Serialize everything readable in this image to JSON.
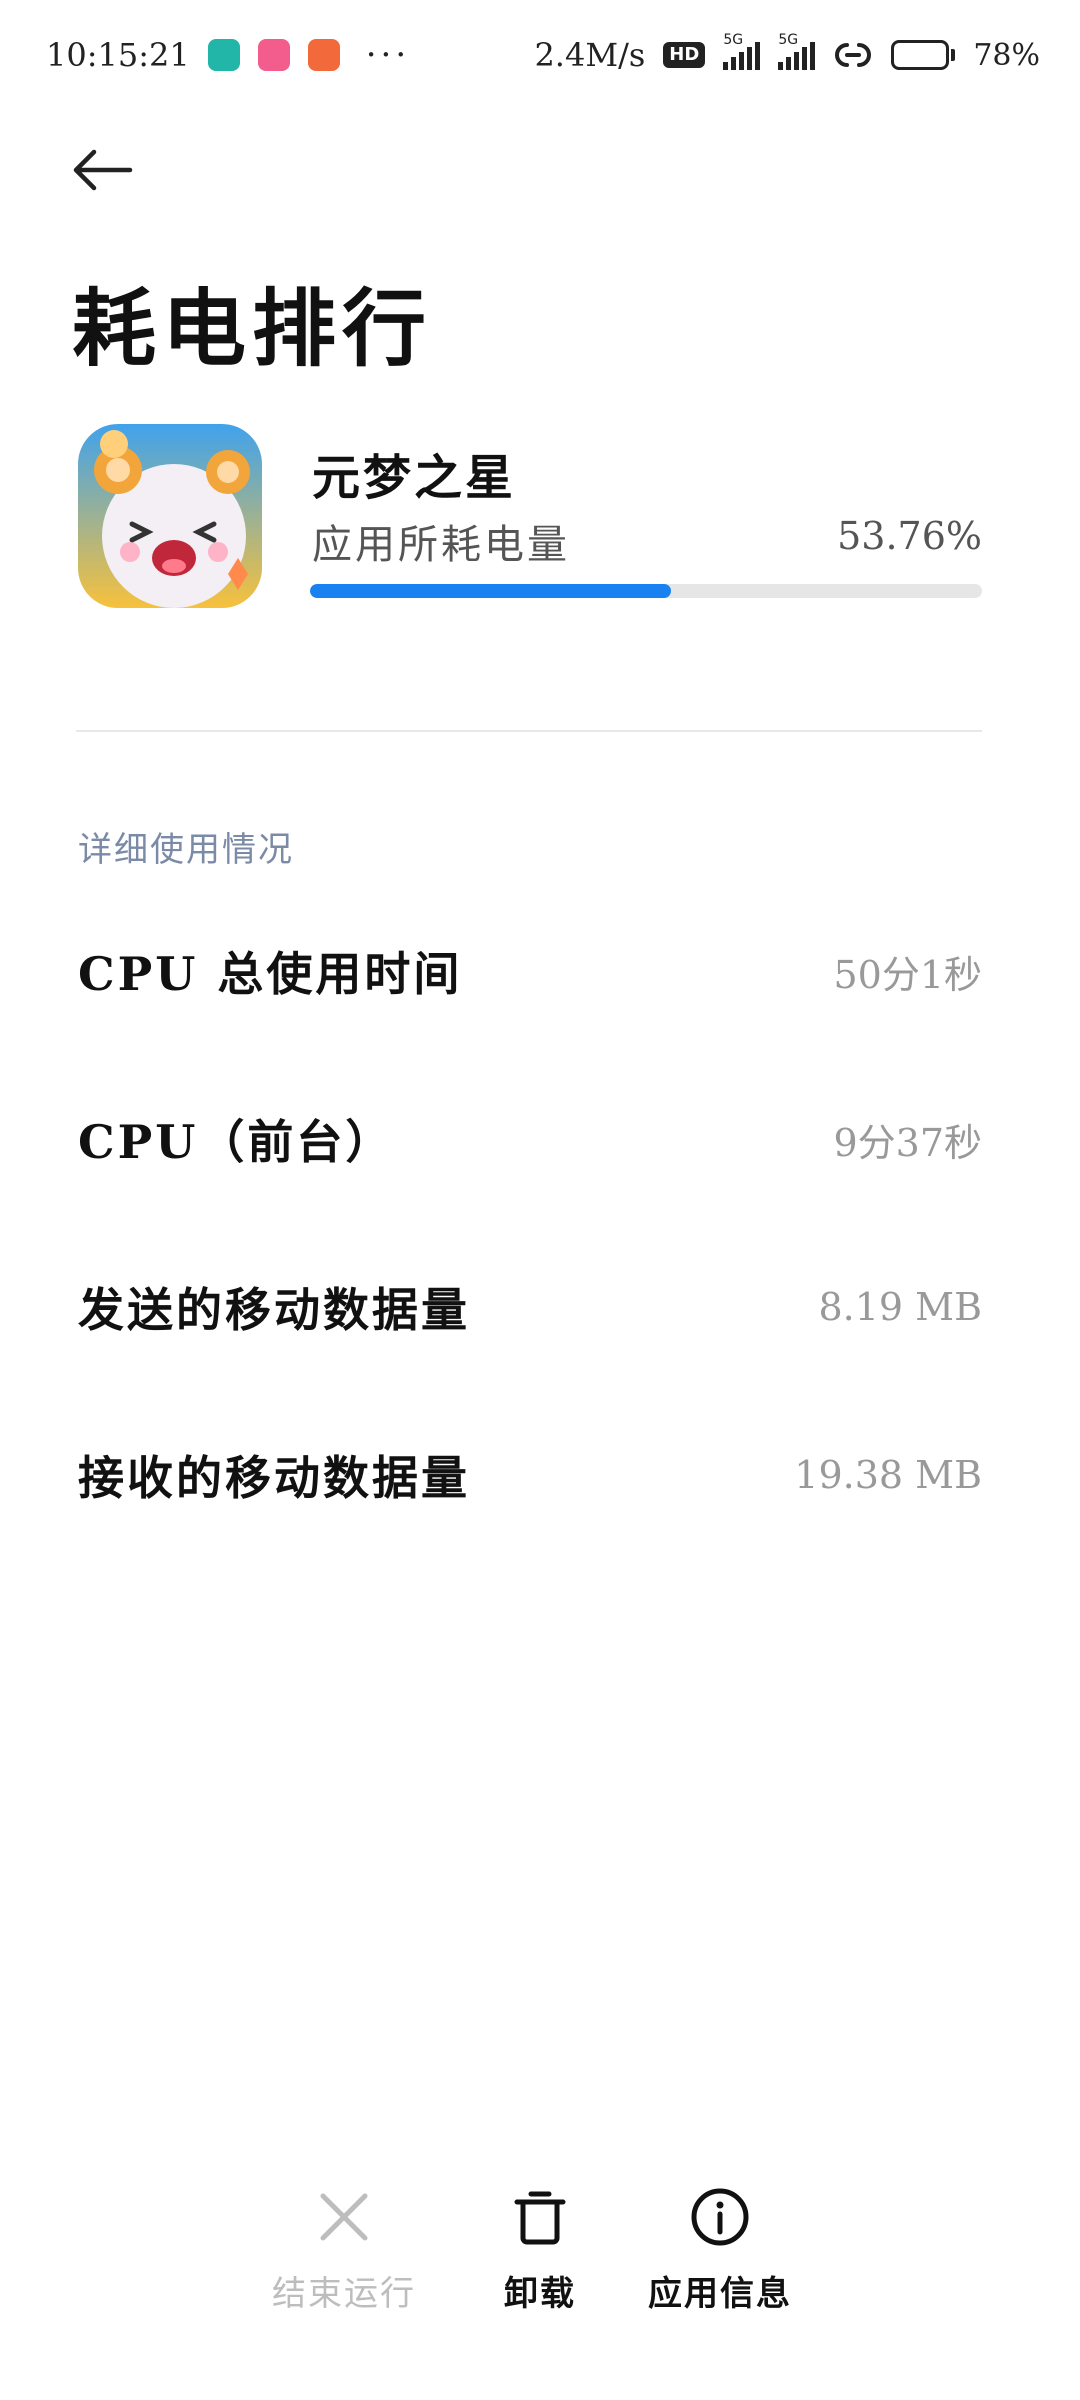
{
  "status_bar": {
    "time": "10:15:21",
    "app_icons": [
      {
        "name": "boss-zhipin-icon",
        "color": "#21b6a8"
      },
      {
        "name": "bilibili-icon",
        "color": "#f25d8e"
      },
      {
        "name": "mi-icon",
        "color": "#f26a3c"
      }
    ],
    "more": "···",
    "net_speed": "2.4M/s",
    "hd_badge": "HD",
    "sim1_label": "5G",
    "sim2_label": "5G",
    "battery_percent": "78%",
    "battery_level": 0.78
  },
  "header": {
    "back_icon": "arrow-left-icon",
    "title": "耗电排行"
  },
  "app": {
    "name": "元梦之星",
    "usage_label": "应用所耗电量",
    "usage_percent_text": "53.76%",
    "usage_fraction": 0.5376,
    "accent_color": "#1a82f0"
  },
  "details": {
    "section_title": "详细使用情况",
    "rows": [
      {
        "label": "CPU 总使用时间",
        "value": "50分1秒"
      },
      {
        "label": "CPU（前台）",
        "value": "9分37秒"
      },
      {
        "label": "发送的移动数据量",
        "value": "8.19 MB"
      },
      {
        "label": "接收的移动数据量",
        "value": "19.38 MB"
      }
    ]
  },
  "actions": [
    {
      "label": "结束运行",
      "icon": "close-icon",
      "enabled": false
    },
    {
      "label": "卸载",
      "icon": "trash-icon",
      "enabled": true
    },
    {
      "label": "应用信息",
      "icon": "info-icon",
      "enabled": true
    }
  ]
}
